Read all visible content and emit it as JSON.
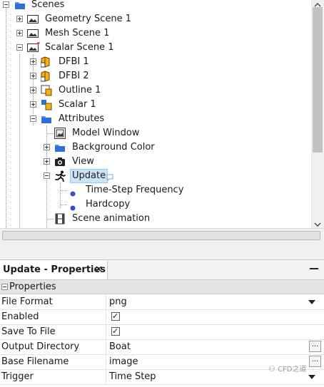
{
  "tree": {
    "scenes": "Scenes",
    "geometry_scene": "Geometry Scene 1",
    "mesh_scene": "Mesh Scene 1",
    "scalar_scene": "Scalar Scene 1",
    "dfbi1": "DFBI 1",
    "dfbi2": "DFBI 2",
    "outline": "Outline 1",
    "scalar": "Scalar 1",
    "attributes": "Attributes",
    "model_window": "Model Window",
    "background_color": "Background Color",
    "view": "View",
    "update": "Update",
    "time_step_frequency": "Time-Step Frequency",
    "hardcopy": "Hardcopy",
    "scene_animation": "Scene animation"
  },
  "properties_panel": {
    "tab_title": "Update - Properties",
    "close_glyph": "✕",
    "minimize_glyph": "—",
    "section_header": "Properties",
    "rows": [
      {
        "name": "File Format",
        "value": "png"
      },
      {
        "name": "Enabled",
        "value": "✓"
      },
      {
        "name": "Save To File",
        "value": "✓"
      },
      {
        "name": "Output Directory",
        "value": "Boat"
      },
      {
        "name": "Base Filename",
        "value": "image"
      },
      {
        "name": "Trigger",
        "value": "Time Step"
      }
    ],
    "ellipsis": "...",
    "watermark": "CFD之道"
  },
  "colors": {
    "folder": "#2f6fd6",
    "selection": "#cce4f7",
    "modified_asterisk": "#cc0000"
  }
}
